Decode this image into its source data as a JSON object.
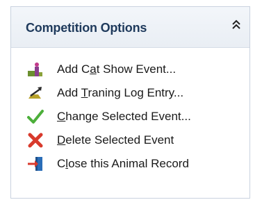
{
  "panel": {
    "title": "Competition Options",
    "collapse_icon": "double-chevron-up-icon"
  },
  "items": [
    {
      "pre": "Add C",
      "u": "a",
      "post": "t Show Event...",
      "icon": "cat-show-icon"
    },
    {
      "pre": "Add ",
      "u": "T",
      "post": "raning Log Entry...",
      "icon": "training-log-icon"
    },
    {
      "pre": "",
      "u": "C",
      "post": "hange Selected Event...",
      "icon": "checkmark-icon"
    },
    {
      "pre": "",
      "u": "D",
      "post": "elete Selected Event",
      "icon": "delete-x-icon"
    },
    {
      "pre": "C",
      "u": "l",
      "post": "ose this Animal Record",
      "icon": "exit-door-icon"
    }
  ],
  "colors": {
    "title": "#1f3a5c",
    "check": "#4caf3a",
    "delete": "#d83a2c",
    "door": "#2a6db8"
  }
}
